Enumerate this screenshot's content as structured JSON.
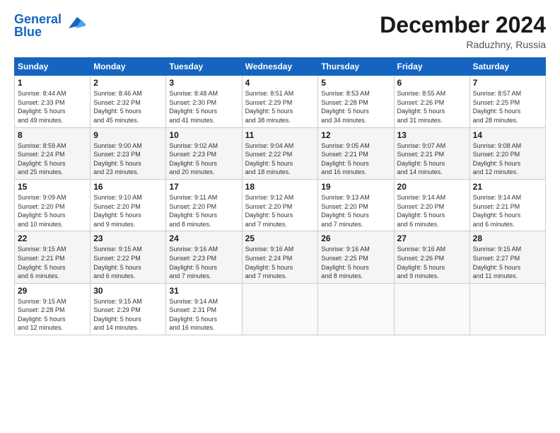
{
  "logo": {
    "line1": "General",
    "line2": "Blue"
  },
  "title": "December 2024",
  "location": "Raduzhny, Russia",
  "days_of_week": [
    "Sunday",
    "Monday",
    "Tuesday",
    "Wednesday",
    "Thursday",
    "Friday",
    "Saturday"
  ],
  "weeks": [
    [
      {
        "day": "1",
        "info": "Sunrise: 8:44 AM\nSunset: 2:33 PM\nDaylight: 5 hours\nand 49 minutes."
      },
      {
        "day": "2",
        "info": "Sunrise: 8:46 AM\nSunset: 2:32 PM\nDaylight: 5 hours\nand 45 minutes."
      },
      {
        "day": "3",
        "info": "Sunrise: 8:48 AM\nSunset: 2:30 PM\nDaylight: 5 hours\nand 41 minutes."
      },
      {
        "day": "4",
        "info": "Sunrise: 8:51 AM\nSunset: 2:29 PM\nDaylight: 5 hours\nand 38 minutes."
      },
      {
        "day": "5",
        "info": "Sunrise: 8:53 AM\nSunset: 2:28 PM\nDaylight: 5 hours\nand 34 minutes."
      },
      {
        "day": "6",
        "info": "Sunrise: 8:55 AM\nSunset: 2:26 PM\nDaylight: 5 hours\nand 31 minutes."
      },
      {
        "day": "7",
        "info": "Sunrise: 8:57 AM\nSunset: 2:25 PM\nDaylight: 5 hours\nand 28 minutes."
      }
    ],
    [
      {
        "day": "8",
        "info": "Sunrise: 8:59 AM\nSunset: 2:24 PM\nDaylight: 5 hours\nand 25 minutes."
      },
      {
        "day": "9",
        "info": "Sunrise: 9:00 AM\nSunset: 2:23 PM\nDaylight: 5 hours\nand 23 minutes."
      },
      {
        "day": "10",
        "info": "Sunrise: 9:02 AM\nSunset: 2:23 PM\nDaylight: 5 hours\nand 20 minutes."
      },
      {
        "day": "11",
        "info": "Sunrise: 9:04 AM\nSunset: 2:22 PM\nDaylight: 5 hours\nand 18 minutes."
      },
      {
        "day": "12",
        "info": "Sunrise: 9:05 AM\nSunset: 2:21 PM\nDaylight: 5 hours\nand 16 minutes."
      },
      {
        "day": "13",
        "info": "Sunrise: 9:07 AM\nSunset: 2:21 PM\nDaylight: 5 hours\nand 14 minutes."
      },
      {
        "day": "14",
        "info": "Sunrise: 9:08 AM\nSunset: 2:20 PM\nDaylight: 5 hours\nand 12 minutes."
      }
    ],
    [
      {
        "day": "15",
        "info": "Sunrise: 9:09 AM\nSunset: 2:20 PM\nDaylight: 5 hours\nand 10 minutes."
      },
      {
        "day": "16",
        "info": "Sunrise: 9:10 AM\nSunset: 2:20 PM\nDaylight: 5 hours\nand 9 minutes."
      },
      {
        "day": "17",
        "info": "Sunrise: 9:11 AM\nSunset: 2:20 PM\nDaylight: 5 hours\nand 8 minutes."
      },
      {
        "day": "18",
        "info": "Sunrise: 9:12 AM\nSunset: 2:20 PM\nDaylight: 5 hours\nand 7 minutes."
      },
      {
        "day": "19",
        "info": "Sunrise: 9:13 AM\nSunset: 2:20 PM\nDaylight: 5 hours\nand 7 minutes."
      },
      {
        "day": "20",
        "info": "Sunrise: 9:14 AM\nSunset: 2:20 PM\nDaylight: 5 hours\nand 6 minutes."
      },
      {
        "day": "21",
        "info": "Sunrise: 9:14 AM\nSunset: 2:21 PM\nDaylight: 5 hours\nand 6 minutes."
      }
    ],
    [
      {
        "day": "22",
        "info": "Sunrise: 9:15 AM\nSunset: 2:21 PM\nDaylight: 5 hours\nand 6 minutes."
      },
      {
        "day": "23",
        "info": "Sunrise: 9:15 AM\nSunset: 2:22 PM\nDaylight: 5 hours\nand 6 minutes."
      },
      {
        "day": "24",
        "info": "Sunrise: 9:16 AM\nSunset: 2:23 PM\nDaylight: 5 hours\nand 7 minutes."
      },
      {
        "day": "25",
        "info": "Sunrise: 9:16 AM\nSunset: 2:24 PM\nDaylight: 5 hours\nand 7 minutes."
      },
      {
        "day": "26",
        "info": "Sunrise: 9:16 AM\nSunset: 2:25 PM\nDaylight: 5 hours\nand 8 minutes."
      },
      {
        "day": "27",
        "info": "Sunrise: 9:16 AM\nSunset: 2:26 PM\nDaylight: 5 hours\nand 9 minutes."
      },
      {
        "day": "28",
        "info": "Sunrise: 9:15 AM\nSunset: 2:27 PM\nDaylight: 5 hours\nand 11 minutes."
      }
    ],
    [
      {
        "day": "29",
        "info": "Sunrise: 9:15 AM\nSunset: 2:28 PM\nDaylight: 5 hours\nand 12 minutes."
      },
      {
        "day": "30",
        "info": "Sunrise: 9:15 AM\nSunset: 2:29 PM\nDaylight: 5 hours\nand 14 minutes."
      },
      {
        "day": "31",
        "info": "Sunrise: 9:14 AM\nSunset: 2:31 PM\nDaylight: 5 hours\nand 16 minutes."
      },
      {
        "day": "",
        "info": ""
      },
      {
        "day": "",
        "info": ""
      },
      {
        "day": "",
        "info": ""
      },
      {
        "day": "",
        "info": ""
      }
    ]
  ]
}
